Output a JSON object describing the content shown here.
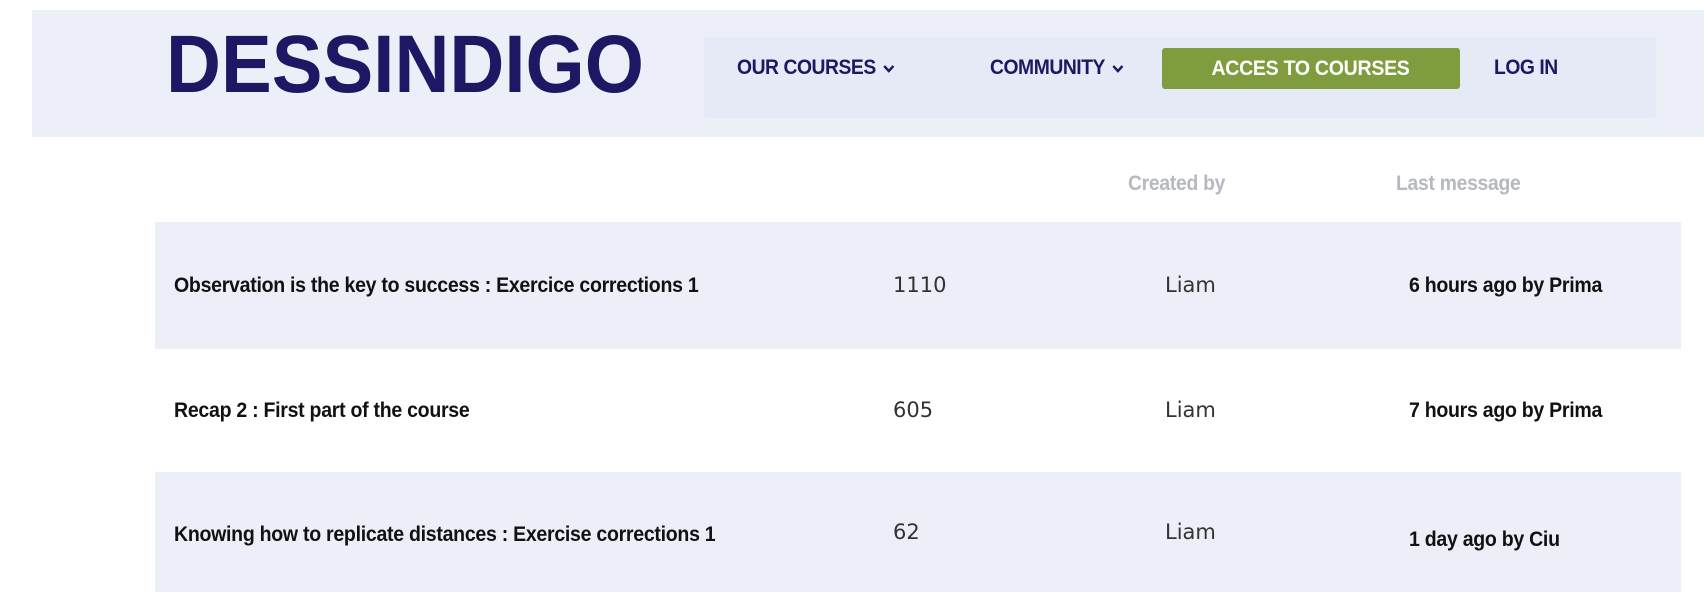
{
  "header": {
    "logo_text": "DESSINDIGO",
    "nav": {
      "courses_label": "OUR COURSES",
      "community_label": "COMMUNITY",
      "cta_label": "ACCES TO COURSES",
      "login_label": "LOG IN"
    }
  },
  "table": {
    "columns": {
      "created_by": "Created by",
      "last_message": "Last message"
    },
    "rows": [
      {
        "title": "Observation is the key to success : Exercice corrections 1",
        "count": "1110",
        "author": "Liam",
        "last": "6 hours ago by Prima"
      },
      {
        "title": "Recap 2 : First part of the course",
        "count": "605",
        "author": "Liam",
        "last": "7 hours ago by Prima"
      },
      {
        "title": "Knowing how to replicate distances : Exercise corrections 1",
        "count": "62",
        "author": "Liam",
        "last": "1 day ago by Ciu"
      }
    ]
  },
  "colors": {
    "brand": "#1e1763",
    "header_bg": "#eceef8",
    "cta_bg": "#7f9d3f",
    "row_shade": "#eceef8"
  },
  "icons": [
    "chevron-down-icon"
  ]
}
